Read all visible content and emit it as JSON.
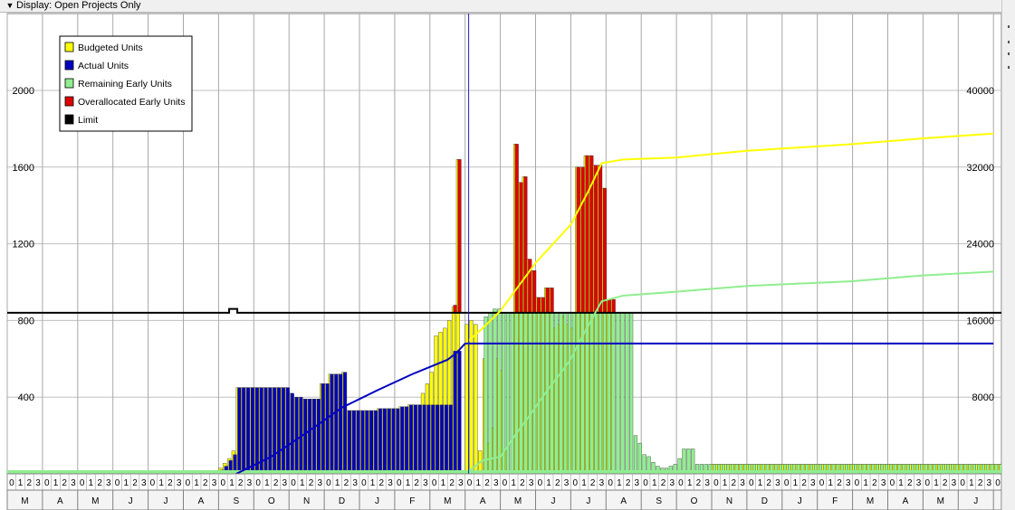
{
  "toolbar": {
    "chevron_icon": "chevron-down-icon",
    "display_label": "Display: Open Projects Only"
  },
  "colors": {
    "budgeted": "#ffff00",
    "actual": "#0000c0",
    "remaining": "#90ee90",
    "overallocated": "#dd0000",
    "limit": "#000000"
  },
  "chart_data": {
    "type": "bar",
    "legend": {
      "placement": "top-left",
      "entries": [
        {
          "label": "Budgeted Units",
          "color": "#ffff00"
        },
        {
          "label": "Actual Units",
          "color": "#0000c0"
        },
        {
          "label": "Remaining Early Units",
          "color": "#90ee90"
        },
        {
          "label": "Overallocated Early Units",
          "color": "#dd0000"
        },
        {
          "label": "Limit",
          "color": "#000000"
        }
      ]
    },
    "y_left": {
      "ylim": [
        0,
        2000
      ],
      "ticks": [
        "400",
        "800",
        "1200",
        "1600",
        "2000"
      ],
      "values": [
        400,
        800,
        1200,
        1600,
        2000
      ]
    },
    "y_right": {
      "ylim": [
        0,
        40000
      ],
      "ticks": [
        "8000",
        "16000",
        "24000",
        "32000",
        "40000"
      ],
      "values": [
        8000,
        16000,
        24000,
        32000,
        40000
      ]
    },
    "grid": true,
    "limit_value": 840,
    "limit_bump": {
      "month_index": 6.3,
      "value": 860
    },
    "current_date_month_index": 13.1,
    "month_labels": [
      "M",
      "A",
      "M",
      "J",
      "J",
      "A",
      "S",
      "O",
      "N",
      "D",
      "J",
      "F",
      "M",
      "A",
      "M",
      "J",
      "J",
      "A",
      "S",
      "O",
      "N",
      "D",
      "J",
      "F",
      "M",
      "A",
      "M",
      "J",
      "J"
    ],
    "week_digits": "0123",
    "bars": {
      "actual": [
        {
          "m": 6.0,
          "v": 20
        },
        {
          "m": 6.125,
          "v": 40
        },
        {
          "m": 6.25,
          "v": 70
        },
        {
          "m": 6.375,
          "v": 100
        },
        {
          "m": 6.5,
          "v": 450
        },
        {
          "m": 6.625,
          "v": 450
        },
        {
          "m": 6.75,
          "v": 450
        },
        {
          "m": 6.875,
          "v": 450
        },
        {
          "m": 7.0,
          "v": 450
        },
        {
          "m": 7.125,
          "v": 450
        },
        {
          "m": 7.25,
          "v": 450
        },
        {
          "m": 7.375,
          "v": 450
        },
        {
          "m": 7.5,
          "v": 450
        },
        {
          "m": 7.625,
          "v": 450
        },
        {
          "m": 7.75,
          "v": 450
        },
        {
          "m": 7.875,
          "v": 450
        },
        {
          "m": 8.0,
          "v": 420
        },
        {
          "m": 8.125,
          "v": 400
        },
        {
          "m": 8.25,
          "v": 400
        },
        {
          "m": 8.375,
          "v": 390
        },
        {
          "m": 8.5,
          "v": 390
        },
        {
          "m": 8.625,
          "v": 390
        },
        {
          "m": 8.75,
          "v": 390
        },
        {
          "m": 8.875,
          "v": 470
        },
        {
          "m": 9.0,
          "v": 470
        },
        {
          "m": 9.125,
          "v": 520
        },
        {
          "m": 9.25,
          "v": 520
        },
        {
          "m": 9.375,
          "v": 520
        },
        {
          "m": 9.5,
          "v": 530
        },
        {
          "m": 9.625,
          "v": 330
        },
        {
          "m": 9.75,
          "v": 330
        },
        {
          "m": 9.875,
          "v": 330
        },
        {
          "m": 10.0,
          "v": 330
        },
        {
          "m": 10.125,
          "v": 330
        },
        {
          "m": 10.25,
          "v": 330
        },
        {
          "m": 10.375,
          "v": 330
        },
        {
          "m": 10.5,
          "v": 340
        },
        {
          "m": 10.625,
          "v": 340
        },
        {
          "m": 10.75,
          "v": 340
        },
        {
          "m": 10.875,
          "v": 340
        },
        {
          "m": 11.0,
          "v": 340
        },
        {
          "m": 11.125,
          "v": 350
        },
        {
          "m": 11.25,
          "v": 350
        },
        {
          "m": 11.375,
          "v": 360
        },
        {
          "m": 11.5,
          "v": 360
        },
        {
          "m": 11.625,
          "v": 360
        },
        {
          "m": 11.75,
          "v": 360
        },
        {
          "m": 11.875,
          "v": 360
        },
        {
          "m": 12.0,
          "v": 360
        },
        {
          "m": 12.125,
          "v": 360
        },
        {
          "m": 12.25,
          "v": 360
        },
        {
          "m": 12.375,
          "v": 360
        },
        {
          "m": 12.5,
          "v": 360
        },
        {
          "m": 12.625,
          "v": 640
        },
        {
          "m": 12.75,
          "v": 640
        }
      ],
      "budgeted": [
        {
          "m": 6.0,
          "v": 30
        },
        {
          "m": 6.125,
          "v": 55
        },
        {
          "m": 6.25,
          "v": 80
        },
        {
          "m": 6.375,
          "v": 120
        },
        {
          "m": 6.5,
          "v": 450
        },
        {
          "m": 6.625,
          "v": 450
        },
        {
          "m": 6.75,
          "v": 450
        },
        {
          "m": 6.875,
          "v": 450
        },
        {
          "m": 7.0,
          "v": 450
        },
        {
          "m": 7.125,
          "v": 450
        },
        {
          "m": 7.25,
          "v": 450
        },
        {
          "m": 7.375,
          "v": 450
        },
        {
          "m": 7.5,
          "v": 450
        },
        {
          "m": 7.625,
          "v": 450
        },
        {
          "m": 7.75,
          "v": 450
        },
        {
          "m": 7.875,
          "v": 450
        },
        {
          "m": 8.0,
          "v": 420
        },
        {
          "m": 8.125,
          "v": 400
        },
        {
          "m": 8.25,
          "v": 400
        },
        {
          "m": 8.375,
          "v": 390
        },
        {
          "m": 8.5,
          "v": 390
        },
        {
          "m": 8.625,
          "v": 390
        },
        {
          "m": 8.75,
          "v": 390
        },
        {
          "m": 8.875,
          "v": 470
        },
        {
          "m": 9.0,
          "v": 470
        },
        {
          "m": 9.125,
          "v": 520
        },
        {
          "m": 9.25,
          "v": 520
        },
        {
          "m": 9.375,
          "v": 520
        },
        {
          "m": 9.5,
          "v": 530
        },
        {
          "m": 9.625,
          "v": 330
        },
        {
          "m": 9.75,
          "v": 330
        },
        {
          "m": 9.875,
          "v": 330
        },
        {
          "m": 10.0,
          "v": 330
        },
        {
          "m": 10.125,
          "v": 330
        },
        {
          "m": 10.25,
          "v": 330
        },
        {
          "m": 10.375,
          "v": 330
        },
        {
          "m": 10.5,
          "v": 340
        },
        {
          "m": 10.625,
          "v": 340
        },
        {
          "m": 10.75,
          "v": 340
        },
        {
          "m": 10.875,
          "v": 340
        },
        {
          "m": 11.0,
          "v": 340
        },
        {
          "m": 11.125,
          "v": 350
        },
        {
          "m": 11.25,
          "v": 350
        },
        {
          "m": 11.375,
          "v": 360
        },
        {
          "m": 11.5,
          "v": 360
        },
        {
          "m": 11.625,
          "v": 360
        },
        {
          "m": 11.75,
          "v": 420
        },
        {
          "m": 11.875,
          "v": 470
        },
        {
          "m": 12.0,
          "v": 530
        },
        {
          "m": 12.125,
          "v": 720
        },
        {
          "m": 12.25,
          "v": 740
        },
        {
          "m": 12.375,
          "v": 760
        },
        {
          "m": 12.5,
          "v": 800
        },
        {
          "m": 12.625,
          "v": 870
        },
        {
          "m": 12.75,
          "v": 1640
        }
      ],
      "remaining": [
        {
          "m": 13.5,
          "v": 820
        },
        {
          "m": 13.625,
          "v": 840
        },
        {
          "m": 13.75,
          "v": 860
        },
        {
          "m": 13.875,
          "v": 860
        },
        {
          "m": 14.0,
          "v": 840
        },
        {
          "m": 14.125,
          "v": 840
        },
        {
          "m": 14.25,
          "v": 840
        },
        {
          "m": 14.375,
          "v": 840
        },
        {
          "m": 14.5,
          "v": 840
        },
        {
          "m": 14.625,
          "v": 840
        },
        {
          "m": 14.75,
          "v": 840
        },
        {
          "m": 14.875,
          "v": 840
        },
        {
          "m": 15.0,
          "v": 840
        },
        {
          "m": 15.125,
          "v": 840
        },
        {
          "m": 15.25,
          "v": 840
        },
        {
          "m": 15.375,
          "v": 840
        },
        {
          "m": 15.5,
          "v": 840
        },
        {
          "m": 15.625,
          "v": 840
        },
        {
          "m": 15.75,
          "v": 840
        },
        {
          "m": 15.875,
          "v": 840
        },
        {
          "m": 16.0,
          "v": 840
        },
        {
          "m": 16.125,
          "v": 840
        },
        {
          "m": 16.25,
          "v": 840
        },
        {
          "m": 16.375,
          "v": 840
        },
        {
          "m": 16.5,
          "v": 840
        },
        {
          "m": 16.625,
          "v": 840
        },
        {
          "m": 16.75,
          "v": 840
        },
        {
          "m": 16.875,
          "v": 840
        },
        {
          "m": 17.0,
          "v": 840
        },
        {
          "m": 17.125,
          "v": 840
        },
        {
          "m": 17.25,
          "v": 840
        },
        {
          "m": 17.375,
          "v": 840
        },
        {
          "m": 17.5,
          "v": 840
        },
        {
          "m": 17.625,
          "v": 840
        },
        {
          "m": 17.75,
          "v": 200
        },
        {
          "m": 17.875,
          "v": 160
        },
        {
          "m": 18.0,
          "v": 100
        },
        {
          "m": 18.125,
          "v": 90
        },
        {
          "m": 18.25,
          "v": 60
        },
        {
          "m": 18.375,
          "v": 40
        },
        {
          "m": 18.5,
          "v": 30
        },
        {
          "m": 18.625,
          "v": 30
        },
        {
          "m": 18.75,
          "v": 40
        },
        {
          "m": 18.875,
          "v": 50
        },
        {
          "m": 19.0,
          "v": 80
        },
        {
          "m": 19.125,
          "v": 130
        },
        {
          "m": 19.25,
          "v": 130
        },
        {
          "m": 19.375,
          "v": 130
        },
        {
          "m": 19.5,
          "v": 50
        },
        {
          "m": 19.625,
          "v": 50
        },
        {
          "m": 19.75,
          "v": 50
        },
        {
          "m": 19.875,
          "v": 50
        }
      ],
      "budgeted_future": [
        {
          "m": 13.0,
          "v": 780
        },
        {
          "m": 13.125,
          "v": 800
        },
        {
          "m": 13.25,
          "v": 780
        },
        {
          "m": 13.375,
          "v": 120
        },
        {
          "m": 13.5,
          "v": 600
        },
        {
          "m": 13.625,
          "v": 160
        },
        {
          "m": 13.75,
          "v": 240
        },
        {
          "m": 13.875,
          "v": 600
        },
        {
          "m": 14.0,
          "v": 540
        },
        {
          "m": 14.125,
          "v": 120
        },
        {
          "m": 14.375,
          "v": 1720
        },
        {
          "m": 14.5,
          "v": 1520
        },
        {
          "m": 14.625,
          "v": 1550
        },
        {
          "m": 14.75,
          "v": 1120
        },
        {
          "m": 14.875,
          "v": 1060
        },
        {
          "m": 15.0,
          "v": 920
        },
        {
          "m": 15.125,
          "v": 920
        },
        {
          "m": 15.25,
          "v": 970
        },
        {
          "m": 15.375,
          "v": 970
        },
        {
          "m": 15.5,
          "v": 760
        },
        {
          "m": 15.625,
          "v": 780
        },
        {
          "m": 15.75,
          "v": 820
        },
        {
          "m": 15.875,
          "v": 780
        },
        {
          "m": 16.0,
          "v": 760
        },
        {
          "m": 16.125,
          "v": 1600
        },
        {
          "m": 16.25,
          "v": 1600
        },
        {
          "m": 16.375,
          "v": 1660
        },
        {
          "m": 16.5,
          "v": 1660
        },
        {
          "m": 16.625,
          "v": 1610
        },
        {
          "m": 16.75,
          "v": 1610
        },
        {
          "m": 16.875,
          "v": 1490
        },
        {
          "m": 17.0,
          "v": 910
        },
        {
          "m": 17.125,
          "v": 910
        }
      ],
      "overallocated": [
        {
          "m": 12.625,
          "v": 880
        },
        {
          "m": 12.75,
          "v": 1640
        },
        {
          "m": 14.375,
          "v": 1720
        },
        {
          "m": 14.5,
          "v": 1520
        },
        {
          "m": 14.625,
          "v": 1550
        },
        {
          "m": 14.75,
          "v": 1120
        },
        {
          "m": 14.875,
          "v": 1060
        },
        {
          "m": 15.0,
          "v": 920
        },
        {
          "m": 15.125,
          "v": 920
        },
        {
          "m": 15.25,
          "v": 970
        },
        {
          "m": 15.375,
          "v": 970
        },
        {
          "m": 16.125,
          "v": 1600
        },
        {
          "m": 16.25,
          "v": 1600
        },
        {
          "m": 16.375,
          "v": 1660
        },
        {
          "m": 16.5,
          "v": 1660
        },
        {
          "m": 16.625,
          "v": 1610
        },
        {
          "m": 16.75,
          "v": 1610
        },
        {
          "m": 16.875,
          "v": 1490
        },
        {
          "m": 17.0,
          "v": 910
        },
        {
          "m": 17.125,
          "v": 910
        }
      ],
      "tail_value": 50
    },
    "cumulative": {
      "actual": [
        {
          "m": 6.5,
          "v": 0
        },
        {
          "m": 7.5,
          "v": 1800
        },
        {
          "m": 8.5,
          "v": 4300
        },
        {
          "m": 9.5,
          "v": 6900
        },
        {
          "m": 10.5,
          "v": 8700
        },
        {
          "m": 11.5,
          "v": 10400
        },
        {
          "m": 12.5,
          "v": 11900
        },
        {
          "m": 12.75,
          "v": 12600
        },
        {
          "m": 13.0,
          "v": 13600
        },
        {
          "m": 28.0,
          "v": 13600
        }
      ],
      "budgeted": [
        {
          "m": 13.0,
          "v": 13600
        },
        {
          "m": 13.5,
          "v": 15200
        },
        {
          "m": 14.0,
          "v": 17000
        },
        {
          "m": 14.5,
          "v": 19500
        },
        {
          "m": 15.0,
          "v": 22000
        },
        {
          "m": 15.5,
          "v": 24000
        },
        {
          "m": 16.0,
          "v": 26000
        },
        {
          "m": 16.5,
          "v": 29500
        },
        {
          "m": 16.875,
          "v": 32400
        },
        {
          "m": 17.5,
          "v": 32800
        },
        {
          "m": 19.0,
          "v": 33000
        },
        {
          "m": 21.0,
          "v": 33700
        },
        {
          "m": 24.0,
          "v": 34400
        },
        {
          "m": 26.0,
          "v": 35000
        },
        {
          "m": 28.0,
          "v": 35500
        }
      ],
      "remaining": [
        {
          "m": 13.0,
          "v": 0
        },
        {
          "m": 13.5,
          "v": 1400
        },
        {
          "m": 14.0,
          "v": 1800
        },
        {
          "m": 14.5,
          "v": 4400
        },
        {
          "m": 15.0,
          "v": 7000
        },
        {
          "m": 15.5,
          "v": 9500
        },
        {
          "m": 16.0,
          "v": 12000
        },
        {
          "m": 16.5,
          "v": 15500
        },
        {
          "m": 16.875,
          "v": 18000
        },
        {
          "m": 17.5,
          "v": 18600
        },
        {
          "m": 19.0,
          "v": 19000
        },
        {
          "m": 21.0,
          "v": 19600
        },
        {
          "m": 24.0,
          "v": 20100
        },
        {
          "m": 26.0,
          "v": 20700
        },
        {
          "m": 28.0,
          "v": 21100
        }
      ]
    }
  }
}
